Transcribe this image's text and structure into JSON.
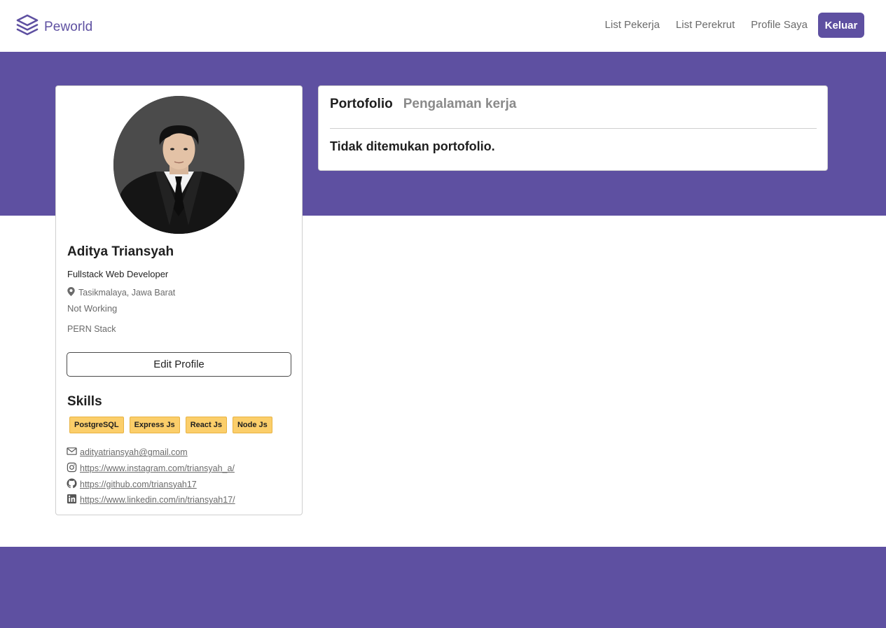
{
  "navbar": {
    "brand": "Peworld",
    "links": [
      "List Pekerja",
      "List Perekrut",
      "Profile Saya"
    ],
    "logout_label": "Keluar"
  },
  "profile": {
    "name": "Aditya Triansyah",
    "job": "Fullstack Web Developer",
    "location": "Tasikmalaya, Jawa Barat",
    "status": "Not Working",
    "description": "PERN Stack",
    "edit_label": "Edit Profile",
    "skills_title": "Skills",
    "skills": [
      "PostgreSQL",
      "Express Js",
      "React Js",
      "Node Js"
    ],
    "contacts": {
      "email": "adityatriansyah@gmail.com",
      "instagram": " https://www.instagram.com/triansyah_a/",
      "github": " https://github.com/triansyah17",
      "linkedin": " https://www.linkedin.com/in/triansyah17/"
    }
  },
  "portfolio": {
    "tabs": [
      "Portofolio",
      "Pengalaman kerja"
    ],
    "active_tab": "Portofolio",
    "empty_message": "Tidak ditemukan portofolio."
  },
  "colors": {
    "brand": "#5e50a1",
    "skill_badge": "#fbce6a"
  },
  "icons": {
    "logo": "stacked-layers-icon",
    "location": "map-pin-icon",
    "email": "envelope-icon",
    "instagram": "instagram-icon",
    "github": "github-icon",
    "linkedin": "linkedin-icon"
  }
}
